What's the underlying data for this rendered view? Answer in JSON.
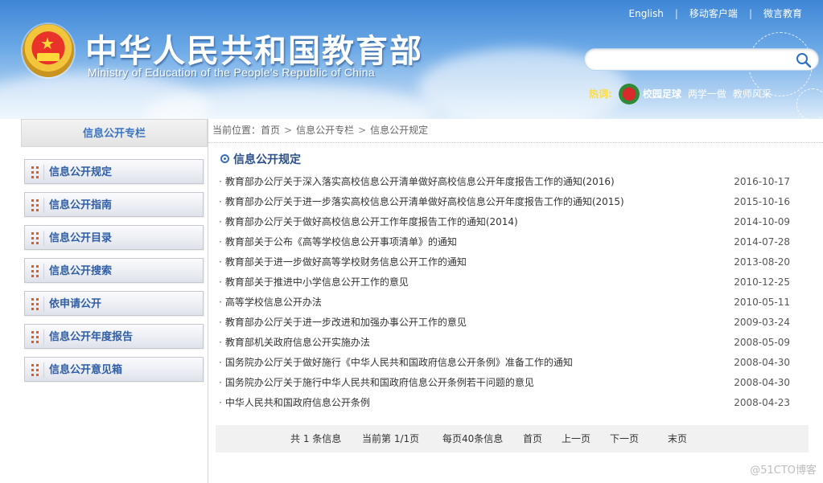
{
  "header": {
    "title_cn": "中华人民共和国教育部",
    "title_en": "Ministry of Education of the People's Republic of China",
    "top_links": [
      "English",
      "移动客户端",
      "微言教育"
    ],
    "search": {
      "placeholder": ""
    },
    "hot": {
      "label": "热词:",
      "links": [
        "校园足球",
        "两学一做",
        "教师风采"
      ]
    }
  },
  "sidebar": {
    "title": "信息公开专栏",
    "items": [
      {
        "label": "信息公开规定"
      },
      {
        "label": "信息公开指南"
      },
      {
        "label": "信息公开目录"
      },
      {
        "label": "信息公开搜索"
      },
      {
        "label": "依申请公开"
      },
      {
        "label": "信息公开年度报告"
      },
      {
        "label": "信息公开意见箱"
      }
    ]
  },
  "breadcrumb": {
    "prefix": "当前位置：",
    "items": [
      "首页",
      "信息公开专栏",
      "信息公开规定"
    ],
    "sep": ">"
  },
  "main": {
    "section_title": "信息公开规定",
    "news": [
      {
        "title": "教育部办公厅关于深入落实高校信息公开清单做好高校信息公开年度报告工作的通知(2016)",
        "date": "2016-10-17"
      },
      {
        "title": "教育部办公厅关于进一步落实高校信息公开清单做好高校信息公开年度报告工作的通知(2015)",
        "date": "2015-10-16"
      },
      {
        "title": "教育部办公厅关于做好高校信息公开工作年度报告工作的通知(2014)",
        "date": "2014-10-09"
      },
      {
        "title": "教育部关于公布《高等学校信息公开事项清单》的通知",
        "date": "2014-07-28"
      },
      {
        "title": "教育部关于进一步做好高等学校财务信息公开工作的通知",
        "date": "2013-08-20"
      },
      {
        "title": "教育部关于推进中小学信息公开工作的意见",
        "date": "2010-12-25"
      },
      {
        "title": "高等学校信息公开办法",
        "date": "2010-05-11"
      },
      {
        "title": "教育部办公厅关于进一步改进和加强办事公开工作的意见",
        "date": "2009-03-24"
      },
      {
        "title": "教育部机关政府信息公开实施办法",
        "date": "2008-05-09"
      },
      {
        "title": "国务院办公厅关于做好施行《中华人民共和国政府信息公开条例》准备工作的通知",
        "date": "2008-04-30"
      },
      {
        "title": "国务院办公厅关于施行中华人民共和国政府信息公开条例若干问题的意见",
        "date": "2008-04-30"
      },
      {
        "title": "中华人民共和国政府信息公开条例",
        "date": "2008-04-23"
      }
    ],
    "pager": {
      "total": "共 1 条信息",
      "current": "当前第 1/1页",
      "per_page": "每页40条信息",
      "first": "首页",
      "prev": "上一页",
      "next": "下一页",
      "last": "末页"
    }
  },
  "watermark": "@51CTO博客",
  "colors": {
    "accent": "#2f5ea6",
    "bullet": "#e05a23",
    "sky": "#3f86d6"
  }
}
